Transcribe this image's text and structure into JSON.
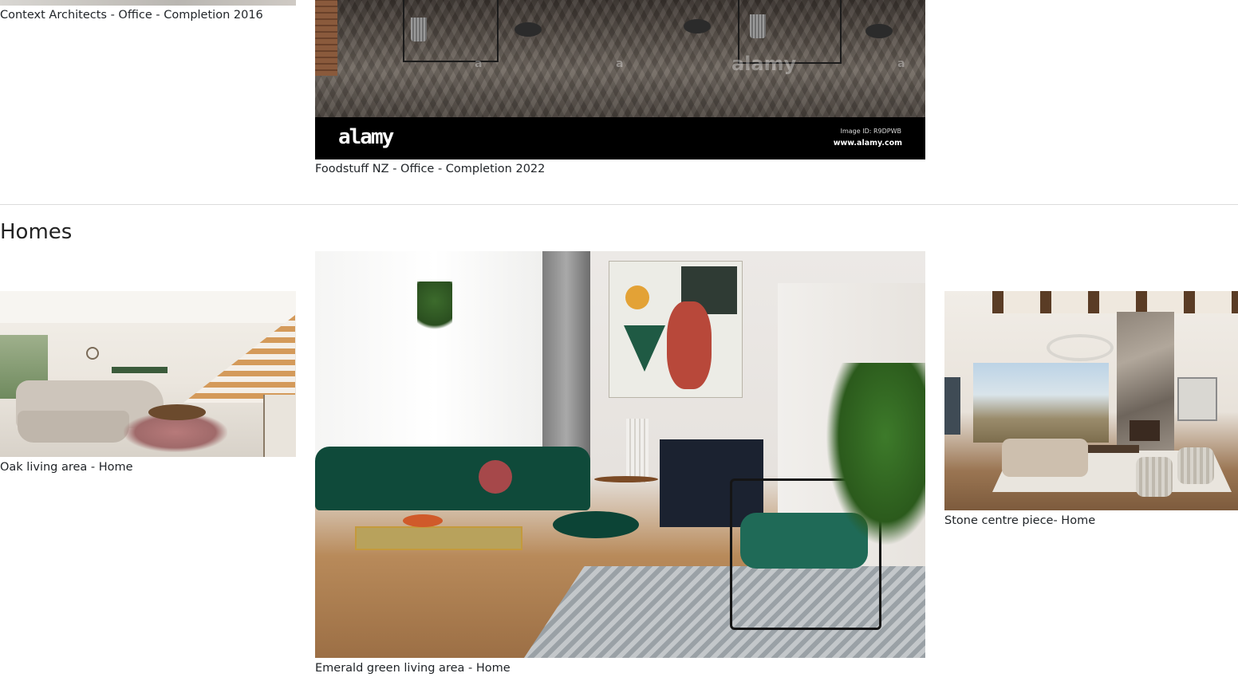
{
  "offices": {
    "items": [
      {
        "caption": "Context Architects - Office - Completion 2016"
      },
      {
        "caption": "Foodstuff NZ - Office - Completion 2022",
        "watermark": {
          "brand": "alamy",
          "image_id": "Image ID: R9DPWB",
          "site": "www.alamy.com",
          "marks": [
            "a",
            "a",
            "alamy",
            "a"
          ]
        }
      }
    ]
  },
  "homes": {
    "heading": "Homes",
    "items": [
      {
        "caption": "Oak living area - Home"
      },
      {
        "caption": "Emerald green living area - Home"
      },
      {
        "caption": "Stone centre piece- Home"
      }
    ]
  },
  "colors": {
    "text": "#212529",
    "divider": "#dcdcdc",
    "emerald": "#0f4a3a"
  }
}
